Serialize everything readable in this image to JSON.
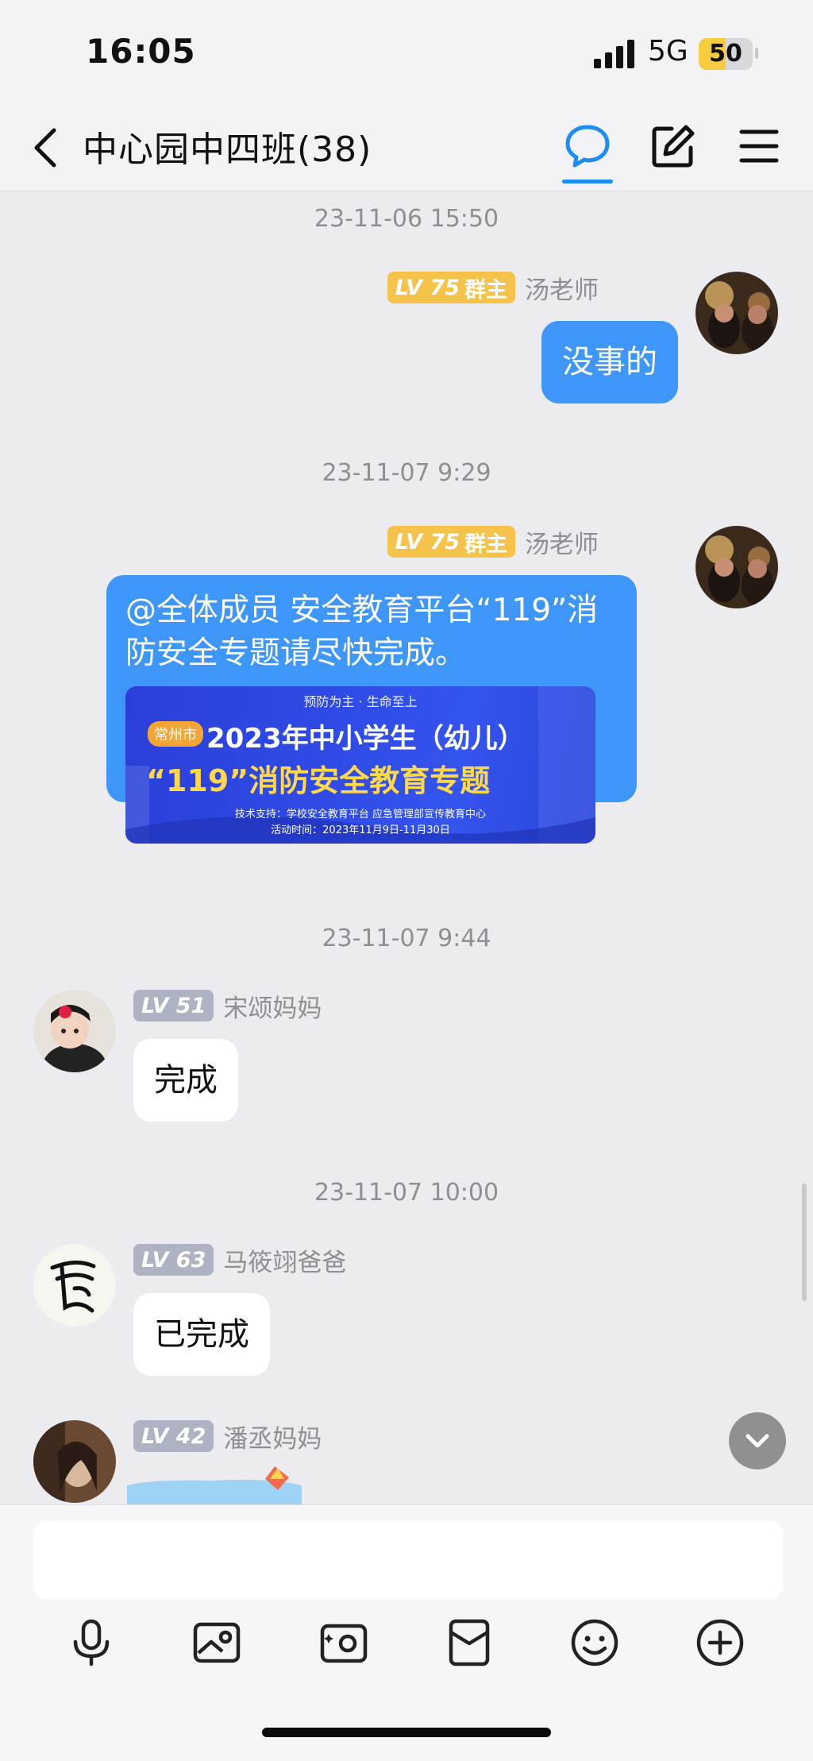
{
  "status_bar": {
    "time": "16:05",
    "network": "5G",
    "battery": "50",
    "battery_fraction": 0.5
  },
  "header": {
    "title": "中心园中四班(38)"
  },
  "messages": [
    {
      "timestamp": "23-11-06 15:50"
    },
    {
      "level": "LV 75",
      "role": "群主",
      "sender": "汤老师",
      "text": "没事的"
    },
    {
      "timestamp": "23-11-07 9:29"
    },
    {
      "level": "LV 75",
      "role": "群主",
      "sender": "汤老师",
      "text_line1": "@全体成员 安全教育平台“119”消",
      "text_line2": "防安全专题请尽快完成。",
      "banner": {
        "top": "预防为主 · 生命至上",
        "city": "常州市",
        "line1": "2023年中小学生（幼儿）",
        "line2": "“119”消防安全教育专题",
        "line3": "技术支持：学校安全教育平台 应急管理部宣传教育中心",
        "line4": "活动时间：2023年11月9日-11月30日"
      }
    },
    {
      "timestamp": "23-11-07 9:44"
    },
    {
      "level": "LV 51",
      "sender": "宋颂妈妈",
      "text": "完成"
    },
    {
      "timestamp": "23-11-07 10:00"
    },
    {
      "level": "LV 63",
      "sender": "马筱翊爸爸",
      "text": "已完成"
    },
    {
      "level": "LV 42",
      "sender": "潘丞妈妈"
    }
  ],
  "input": {
    "placeholder": ""
  },
  "colors": {
    "accent": "#1e8cf0",
    "bubble_out": "#3e97f8",
    "level_owner": "#f6c34a",
    "level_member": "#adb3c2"
  }
}
